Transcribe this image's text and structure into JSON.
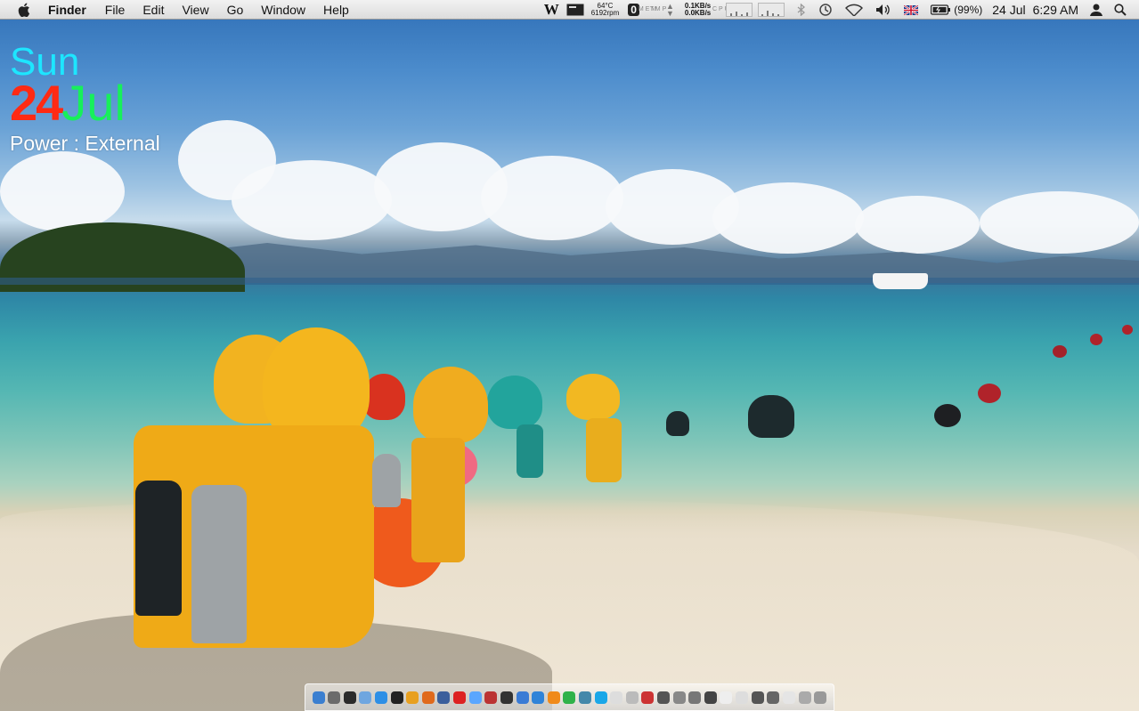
{
  "menubar": {
    "app_name": "Finder",
    "menus": [
      "File",
      "Edit",
      "View",
      "Go",
      "Window",
      "Help"
    ],
    "status": {
      "temperature": "64°C",
      "fan_speed": "6192rpm",
      "network_up": "0.1KB/s",
      "network_down": "0.0KB/s",
      "battery_percent": "(99%)",
      "date": "24 Jul",
      "time": "6:29 AM",
      "w_label": "W",
      "zero_label": "0",
      "mem_label": "M E M",
      "tmp_label": "T M P",
      "cpu_label": "C P U"
    }
  },
  "widget": {
    "day": "Sun",
    "day_number": "24",
    "month": "Jul",
    "power": "Power : External",
    "colors": {
      "day": "#1de6ff",
      "day_number": "#ff2a13",
      "month": "#17f05a"
    }
  },
  "dock": {
    "icons": [
      "finder-icon",
      "system-preferences-icon",
      "activity-monitor-icon",
      "mail-icon",
      "safari-icon",
      "dashboard-icon",
      "chrome-icon",
      "firefox-icon",
      "network-icon",
      "opera-icon",
      "itunes-icon",
      "calendar-icon",
      "terminal-icon",
      "iphoto-icon",
      "app-store-icon",
      "vlc-icon",
      "whatsapp-icon",
      "adium-icon",
      "skype-icon",
      "textedit-icon",
      "preview-icon",
      "pdf-icon",
      "photo-booth-icon",
      "utility-icon",
      "calculator-icon",
      "folder-icon",
      "document-icon",
      "documents-icon",
      "screenshot-icon",
      "stack-icon",
      "keyboard-icon",
      "drive-icon",
      "trash-icon"
    ]
  }
}
